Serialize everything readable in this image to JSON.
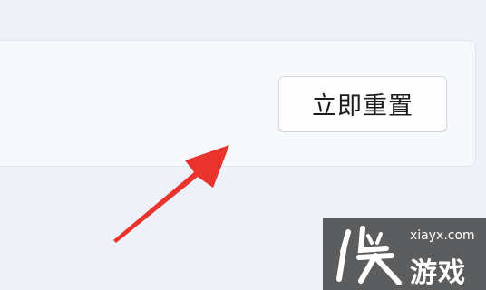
{
  "settings_panel": {
    "reset_button_label": "立即重置"
  },
  "annotation": {
    "arrow_color": "#e8342c",
    "icon": "red-arrow-icon"
  },
  "watermark": {
    "logo_text": "侠",
    "domain": "xiayx.com",
    "name": "游戏"
  },
  "colors": {
    "background": "#eef1f8",
    "card": "#f7f8fc",
    "button": "#fdfdfe"
  }
}
